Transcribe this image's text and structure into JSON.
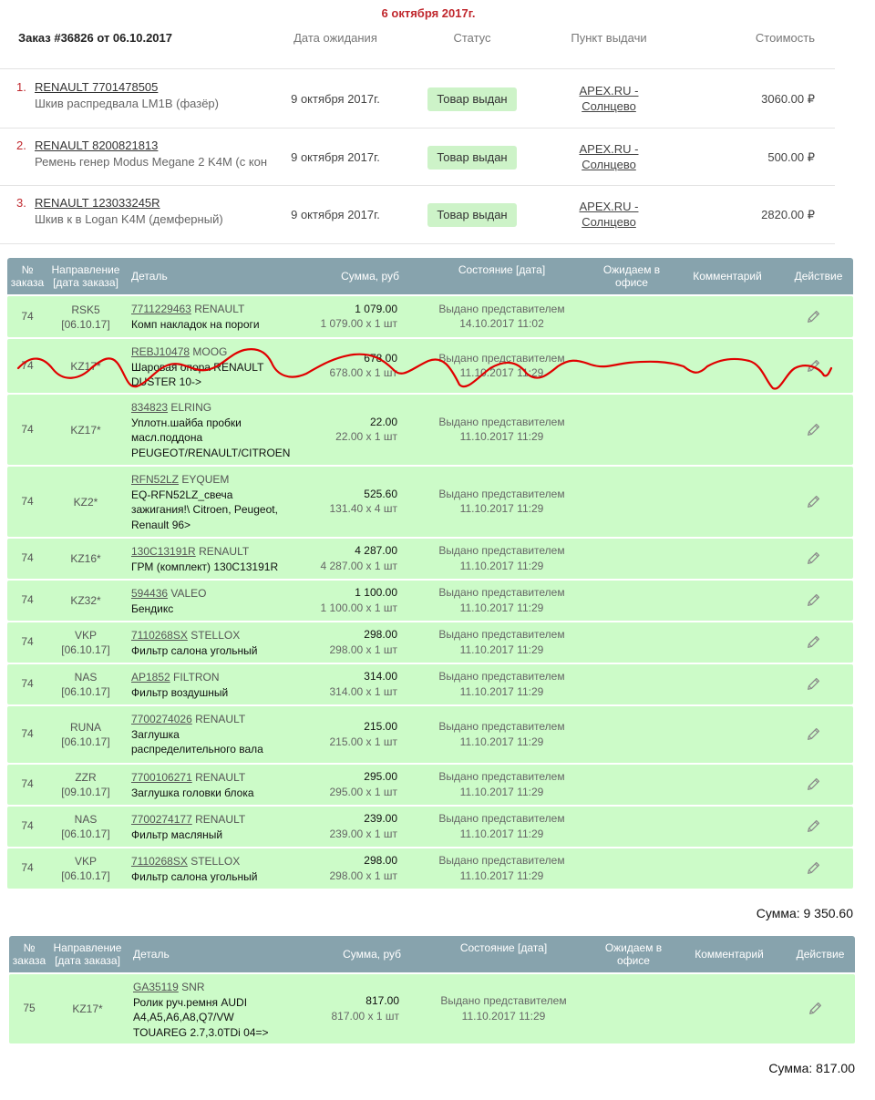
{
  "header": {
    "date_title": "6 октября 2017г.",
    "order_title": "Заказ #36826 от 06.10.2017",
    "col_date": "Дата ожидания",
    "col_status": "Статус",
    "col_point": "Пункт выдачи",
    "col_cost": "Стоимость"
  },
  "order_items": [
    {
      "num": "1.",
      "article": "RENAULT 7701478505",
      "desc": "Шкив распредвала LM1B (фазёр)",
      "date": "9 октября 2017г.",
      "status": "Товар выдан",
      "point": "APEX.RU - Солнцево",
      "price": "3060.00 ₽"
    },
    {
      "num": "2.",
      "article": "RENAULT 8200821813",
      "desc": "Ремень генер Modus Megane 2 K4M (с кон",
      "date": "9 октября 2017г.",
      "status": "Товар выдан",
      "point": "APEX.RU - Солнцево",
      "price": "500.00 ₽"
    },
    {
      "num": "3.",
      "article": "RENAULT 123033245R",
      "desc": "Шкив к в Logan K4M (демферный)",
      "date": "9 октября 2017г.",
      "status": "Товар выдан",
      "point": "APEX.RU - Солнцево",
      "price": "2820.00 ₽"
    }
  ],
  "table_headers": {
    "no": "№ заказа",
    "dir": "Направление [дата заказа]",
    "det": "Деталь",
    "sum": "Сумма, руб",
    "state": "Состояние [дата]",
    "wait": "Ожидаем в офисе",
    "com": "Комментарий",
    "act": "Действие"
  },
  "table1_rows": [
    {
      "no": "74",
      "dir": "RSK5",
      "dir_date": "[06.10.17]",
      "code": "7711229463",
      "brand": "RENAULT",
      "name": "Комп накладок на пороги",
      "sum": "1 079.00",
      "sum_detail": "1 079.00 x 1 шт",
      "state": "Выдано представителем",
      "state_date": "14.10.2017 11:02"
    },
    {
      "no": "74",
      "dir": "KZ17*",
      "dir_date": "",
      "code": "REBJ10478",
      "brand": "MOOG",
      "name": "Шаровая опора RENAULT DUSTER 10->",
      "sum": "678.00",
      "sum_detail": "678.00 x 1 шт",
      "state": "Выдано представителем",
      "state_date": "11.10.2017 11:29"
    },
    {
      "no": "74",
      "dir": "KZ17*",
      "dir_date": "",
      "code": "834823",
      "brand": "ELRING",
      "name": "Уплотн.шайба пробки масл.поддона PEUGEOT/RENAULT/CITROEN",
      "sum": "22.00",
      "sum_detail": "22.00 x 1 шт",
      "state": "Выдано представителем",
      "state_date": "11.10.2017 11:29"
    },
    {
      "no": "74",
      "dir": "KZ2*",
      "dir_date": "",
      "code": "RFN52LZ",
      "brand": "EYQUEM",
      "name": "EQ-RFN52LZ_свеча зажигания!\\ Citroen, Peugeot, Renault 96>",
      "sum": "525.60",
      "sum_detail": "131.40 x 4 шт",
      "state": "Выдано представителем",
      "state_date": "11.10.2017 11:29"
    },
    {
      "no": "74",
      "dir": "KZ16*",
      "dir_date": "",
      "code": "130C13191R",
      "brand": "RENAULT",
      "name": "ГРМ (комплект) 130C13191R",
      "sum": "4 287.00",
      "sum_detail": "4 287.00 x 1 шт",
      "state": "Выдано представителем",
      "state_date": "11.10.2017 11:29"
    },
    {
      "no": "74",
      "dir": "KZ32*",
      "dir_date": "",
      "code": "594436",
      "brand": "VALEO",
      "name": "Бендикс",
      "sum": "1 100.00",
      "sum_detail": "1 100.00 x 1 шт",
      "state": "Выдано представителем",
      "state_date": "11.10.2017 11:29"
    },
    {
      "no": "74",
      "dir": "VKP",
      "dir_date": "[06.10.17]",
      "code": "7110268SX",
      "brand": "STELLOX",
      "name": "Фильтр салона угольный",
      "sum": "298.00",
      "sum_detail": "298.00 x 1 шт",
      "state": "Выдано представителем",
      "state_date": "11.10.2017 11:29"
    },
    {
      "no": "74",
      "dir": "NAS",
      "dir_date": "[06.10.17]",
      "code": "AP1852",
      "brand": "FILTRON",
      "name": "Фильтр воздушный",
      "sum": "314.00",
      "sum_detail": "314.00 x 1 шт",
      "state": "Выдано представителем",
      "state_date": "11.10.2017 11:29"
    },
    {
      "no": "74",
      "dir": "RUNA",
      "dir_date": "[06.10.17]",
      "code": "7700274026",
      "brand": "RENAULT",
      "name": "Заглушка распределительного вала",
      "sum": "215.00",
      "sum_detail": "215.00 x 1 шт",
      "state": "Выдано представителем",
      "state_date": "11.10.2017 11:29"
    },
    {
      "no": "74",
      "dir": "ZZR",
      "dir_date": "[09.10.17]",
      "code": "7700106271",
      "brand": "RENAULT",
      "name": "Заглушка головки блока",
      "sum": "295.00",
      "sum_detail": "295.00 x 1 шт",
      "state": "Выдано представителем",
      "state_date": "11.10.2017 11:29"
    },
    {
      "no": "74",
      "dir": "NAS",
      "dir_date": "[06.10.17]",
      "code": "7700274177",
      "brand": "RENAULT",
      "name": "Фильтр масляный",
      "sum": "239.00",
      "sum_detail": "239.00 x 1 шт",
      "state": "Выдано представителем",
      "state_date": "11.10.2017 11:29"
    },
    {
      "no": "74",
      "dir": "VKP",
      "dir_date": "[06.10.17]",
      "code": "7110268SX",
      "brand": "STELLOX",
      "name": "Фильтр салона угольный",
      "sum": "298.00",
      "sum_detail": "298.00 x 1 шт",
      "state": "Выдано представителем",
      "state_date": "11.10.2017 11:29"
    }
  ],
  "table1_total": "Сумма: 9 350.60",
  "table2_rows": [
    {
      "no": "75",
      "dir": "KZ17*",
      "dir_date": "",
      "code": "GA35119",
      "brand": "SNR",
      "name": "Ролик руч.ремня AUDI A4,A5,A6,A8,Q7/VW TOUAREG 2.7,3.0TDi 04=>",
      "sum": "817.00",
      "sum_detail": "817.00 x 1 шт",
      "state": "Выдано представителем",
      "state_date": "11.10.2017 11:29"
    }
  ],
  "table2_total": "Сумма: 817.00",
  "icons": {
    "edit": "pencil-icon"
  },
  "colors": {
    "accent_red": "#c0272d",
    "header_bg": "#87a3ad",
    "row_bg": "#ccfbc8",
    "badge_bg": "#cdf3c8",
    "scribble": "#e00000"
  }
}
